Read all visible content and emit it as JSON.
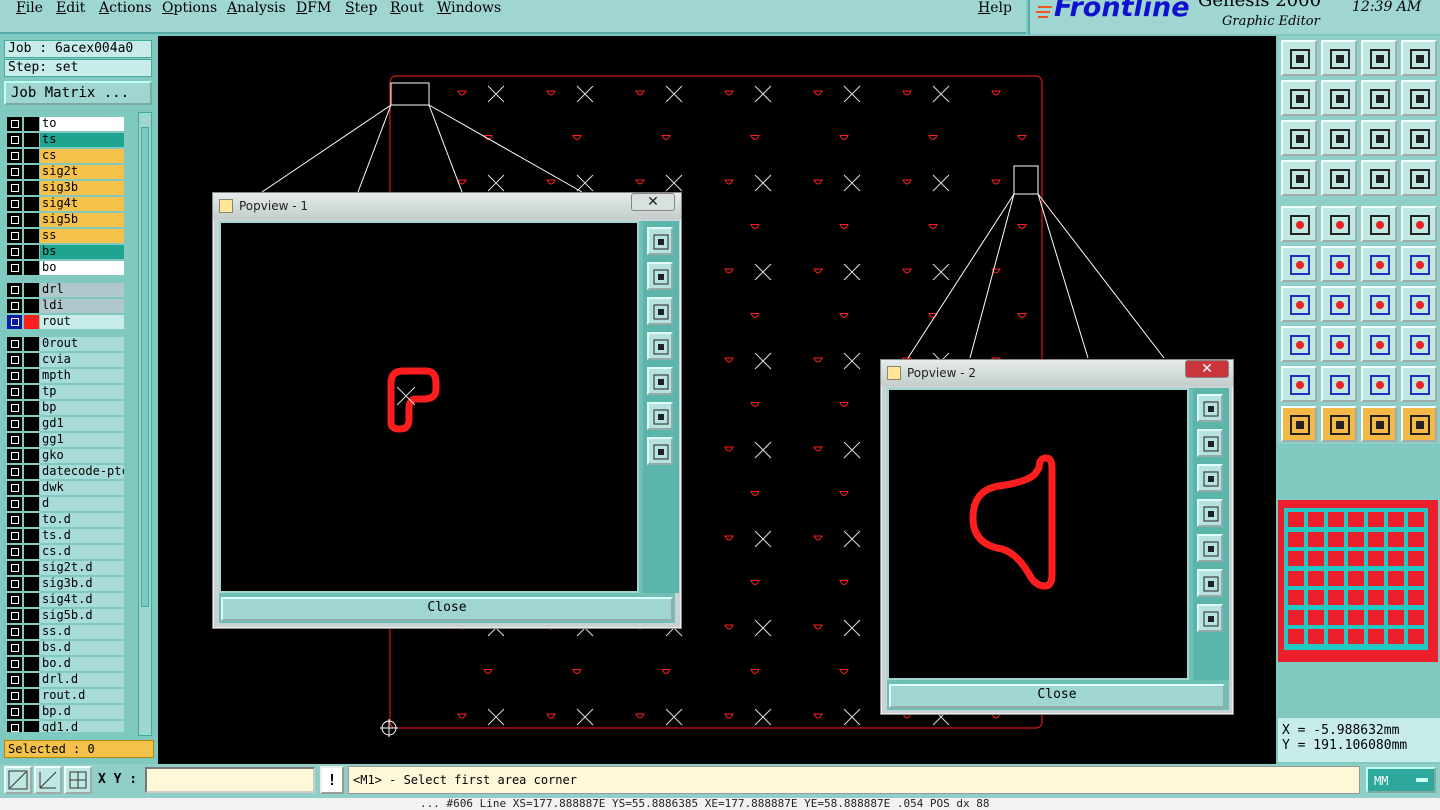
{
  "menu": [
    "File",
    "Edit",
    "Actions",
    "Options",
    "Analysis",
    "DFM",
    "Step",
    "Rout",
    "Windows"
  ],
  "help": "Help",
  "brand": {
    "logo": "Frontline",
    "product": "Genesis 2000",
    "subtitle": "Graphic Editor",
    "time": "12:39 AM"
  },
  "job": {
    "job": "Job : 6acex004a0",
    "step": "Step: set",
    "matrix_button": "Job Matrix ..."
  },
  "layers": [
    {
      "name": "to",
      "bg": "#ffffff"
    },
    {
      "name": "ts",
      "bg": "#1fa58f"
    },
    {
      "name": "cs",
      "bg": "#f4c24a"
    },
    {
      "name": "sig2t",
      "bg": "#f4c24a"
    },
    {
      "name": "sig3b",
      "bg": "#f4c24a"
    },
    {
      "name": "sig4t",
      "bg": "#f4c24a"
    },
    {
      "name": "sig5b",
      "bg": "#f4c24a"
    },
    {
      "name": "ss",
      "bg": "#f4c24a"
    },
    {
      "name": "bs",
      "bg": "#1fa58f"
    },
    {
      "name": "bo",
      "bg": "#ffffff"
    },
    {
      "name": "drl",
      "bg": "#b0c8cc"
    },
    {
      "name": "ldi",
      "bg": "#b0c8cc"
    },
    {
      "name": "rout",
      "bg": "#c8ecea",
      "active": true
    },
    {
      "name": "0rout",
      "bg": "#a8dcd8"
    },
    {
      "name": "cvia",
      "bg": "#a8dcd8"
    },
    {
      "name": "mpth",
      "bg": "#a8dcd8"
    },
    {
      "name": "tp",
      "bg": "#a8dcd8"
    },
    {
      "name": "bp",
      "bg": "#a8dcd8"
    },
    {
      "name": "gd1",
      "bg": "#a8dcd8"
    },
    {
      "name": "gg1",
      "bg": "#a8dcd8"
    },
    {
      "name": "gko",
      "bg": "#a8dcd8"
    },
    {
      "name": "datecode-ptc",
      "bg": "#a8dcd8"
    },
    {
      "name": "dwk",
      "bg": "#a8dcd8"
    },
    {
      "name": "d",
      "bg": "#a8dcd8"
    },
    {
      "name": "to.d",
      "bg": "#a8dcd8"
    },
    {
      "name": "ts.d",
      "bg": "#a8dcd8"
    },
    {
      "name": "cs.d",
      "bg": "#a8dcd8"
    },
    {
      "name": "sig2t.d",
      "bg": "#a8dcd8"
    },
    {
      "name": "sig3b.d",
      "bg": "#a8dcd8"
    },
    {
      "name": "sig4t.d",
      "bg": "#a8dcd8"
    },
    {
      "name": "sig5b.d",
      "bg": "#a8dcd8"
    },
    {
      "name": "ss.d",
      "bg": "#a8dcd8"
    },
    {
      "name": "bs.d",
      "bg": "#a8dcd8"
    },
    {
      "name": "bo.d",
      "bg": "#a8dcd8"
    },
    {
      "name": "drl.d",
      "bg": "#a8dcd8"
    },
    {
      "name": "rout.d",
      "bg": "#a8dcd8"
    },
    {
      "name": "bp.d",
      "bg": "#a8dcd8"
    },
    {
      "name": "gd1.d",
      "bg": "#a8dcd8"
    }
  ],
  "selected": "Selected : 0",
  "popview1": {
    "title": "Popview - 1",
    "close": "Close"
  },
  "popview2": {
    "title": "Popview - 2",
    "close": "Close"
  },
  "coords": {
    "x": "X = -5.988632mm",
    "y": "Y = 191.106080mm"
  },
  "bottom": {
    "xy_label": "X Y :",
    "xy_value": "",
    "message": "<M1> - Select first area corner",
    "units": "MM",
    "status": "... #606 Line XS=177.888887E YS=55.8886385 XE=177.888887E YE=58.888887E  .054 POS dx 88"
  },
  "colors": {
    "feature": "#ff1e1e",
    "background": "#000000",
    "panel": "#7fc9c0",
    "highlight": "#f4c24a"
  },
  "icons": {
    "toolbar": [
      "zoom-home-icon",
      "zoom-in-icon",
      "zoom-out-icon",
      "zoom-area-icon",
      "pan-left-icon",
      "pan-right-icon",
      "pan-center-icon",
      "redraw-icon",
      "fit-icon",
      "zoom-step-icon",
      "scale-1to2-icon",
      "help-icon",
      "measure-icon",
      "snap-icon",
      "display-mode-icon",
      "graphic-mode-icon",
      "select-feature-icon",
      "select-net-icon",
      "ruler-icon",
      "dot-icon",
      "node-connect-icon",
      "cross-feature-icon",
      "line-feature-icon",
      "arc-feature-icon",
      "angle-icon",
      "line-draw-icon",
      "rotate-icon",
      "mirror-icon",
      "pad-add-icon",
      "split-icon",
      "move-icon",
      "group-icon",
      "triangle-a-icon",
      "triangle-b-icon",
      "triangle-c-icon",
      "triangle-d-icon",
      "pointer-icon",
      "pointer-box-icon",
      "pointer-circle-icon",
      "pointer-path-icon"
    ]
  }
}
